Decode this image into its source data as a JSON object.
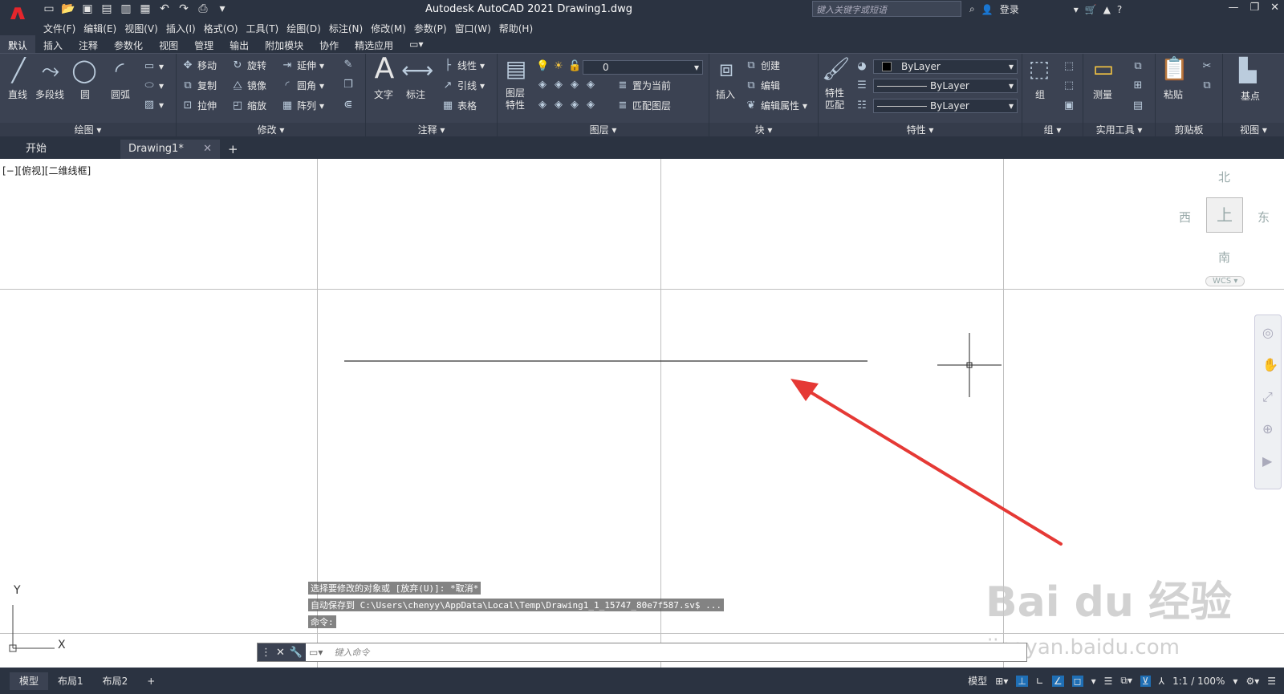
{
  "app": {
    "logo": "A",
    "title": "Autodesk AutoCAD 2021    Drawing1.dwg",
    "search_placeholder": "键入关键字或短语",
    "login": "登录"
  },
  "menu": [
    "文件(F)",
    "编辑(E)",
    "视图(V)",
    "插入(I)",
    "格式(O)",
    "工具(T)",
    "绘图(D)",
    "标注(N)",
    "修改(M)",
    "参数(P)",
    "窗口(W)",
    "帮助(H)"
  ],
  "ribbon_tabs": [
    "默认",
    "插入",
    "注释",
    "参数化",
    "视图",
    "管理",
    "输出",
    "附加模块",
    "协作",
    "精选应用"
  ],
  "panels": {
    "draw": {
      "title": "绘图 ▾",
      "line": "直线",
      "polyline": "多段线",
      "circle": "圆",
      "arc": "圆弧"
    },
    "modify": {
      "title": "修改 ▾",
      "move": "移动",
      "rotate": "旋转",
      "trim": "延伸",
      "copy": "复制",
      "mirror": "镜像",
      "fillet": "圆角",
      "stretch": "拉伸",
      "scale": "缩放",
      "array": "阵列"
    },
    "annotation": {
      "title": "注释 ▾",
      "text": "文字",
      "dim": "标注",
      "linear": "线性",
      "leader": "引线",
      "table": "表格"
    },
    "layers": {
      "title": "图层 ▾",
      "layerprops": "图层\n特性",
      "layer_value": "0",
      "setcurrent": "置为当前",
      "matchlayer": "匹配图层"
    },
    "block": {
      "title": "块 ▾",
      "insert": "插入",
      "create": "创建",
      "edit": "编辑",
      "editattr": "编辑属性"
    },
    "properties": {
      "title": "特性 ▾",
      "match": "特性\n匹配",
      "color": "ByLayer",
      "linetype": "ByLayer",
      "lineweight": "ByLayer"
    },
    "group": {
      "title": "组 ▾",
      "group": "组"
    },
    "utilities": {
      "title": "实用工具 ▾",
      "measure": "测量"
    },
    "clipboard": {
      "title": "剪贴板",
      "paste": "粘贴"
    },
    "view": {
      "title": "视图 ▾",
      "base": "基点"
    }
  },
  "doc_tabs": {
    "start": "开始",
    "drawing": "Drawing1*",
    "close": "✕",
    "add": "+"
  },
  "viewport_label": "[−][俯视][二维线框]",
  "viewcube": {
    "north": "北",
    "south": "南",
    "east": "东",
    "west": "西",
    "top": "上",
    "wcs": "WCS"
  },
  "ucs": {
    "x": "X",
    "y": "Y"
  },
  "command_history": [
    "选择要修改的对象或 [放弃(U)]: *取消*",
    "自动保存到 C:\\Users\\chenyy\\AppData\\Local\\Temp\\Drawing1_1_15747_80e7f587.sv$ ...",
    "命令:"
  ],
  "command_placeholder": "键入命令",
  "status": {
    "tabs": [
      "模型",
      "布局1",
      "布局2"
    ],
    "add": "+",
    "model": "模型",
    "scale": "1:1 / 100%"
  },
  "watermark": {
    "line1": "Bai du 经验",
    "line2": "jingyan.baidu.com"
  },
  "colors": {
    "chrome": "#2b3341",
    "ribbon": "#3b4252",
    "arrow": "#e53935",
    "accent_logo": "#e4262c"
  }
}
